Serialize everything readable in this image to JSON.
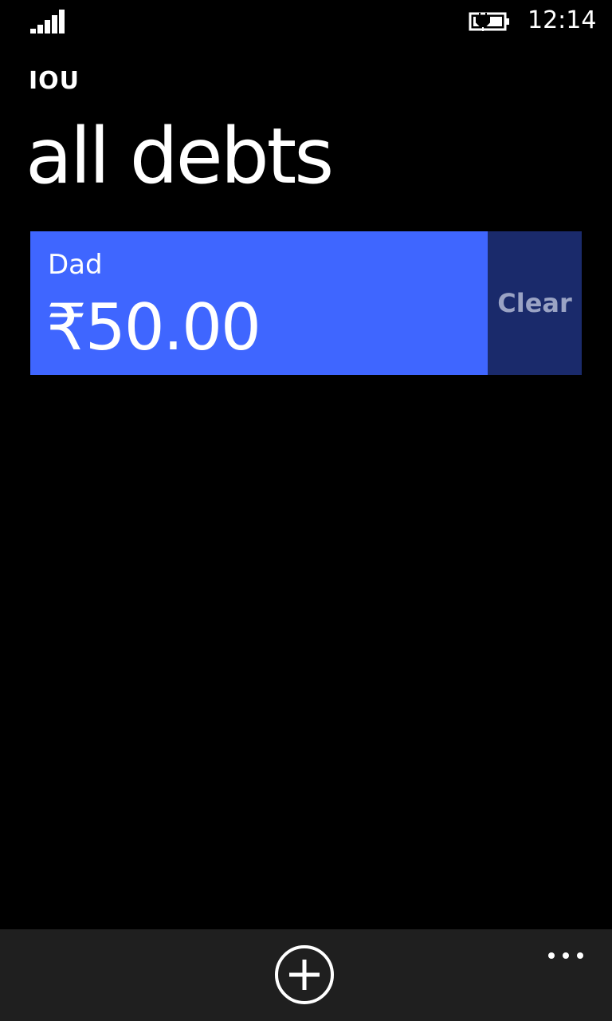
{
  "status_bar": {
    "time": "12:14",
    "signal_icon": "signal-bars-icon",
    "battery_icon": "battery-charging-icon"
  },
  "header": {
    "app_title": "IOU",
    "page_title": "all debts"
  },
  "debts": [
    {
      "name": "Dad",
      "amount": "₹50.00",
      "action_label": "Clear"
    }
  ],
  "app_bar": {
    "add_icon": "add-circle-icon",
    "more_icon": "ellipsis-icon"
  },
  "colors": {
    "background": "#000000",
    "accent": "#3f66ff",
    "clear_bg": "#1a2a6b",
    "clear_text": "#9aa3c4",
    "app_bar_bg": "#1f1f1f",
    "text": "#ffffff"
  }
}
